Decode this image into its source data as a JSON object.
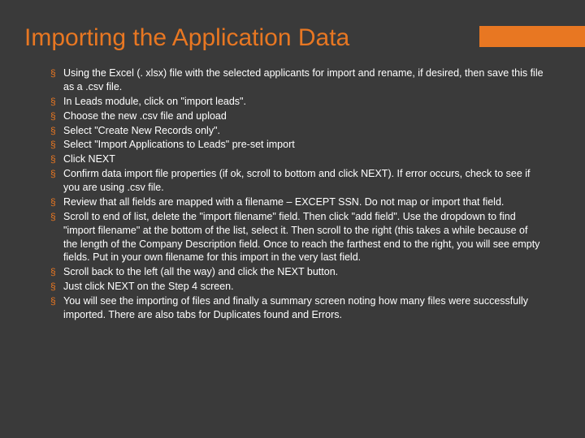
{
  "title": "Importing the Application Data",
  "bullets": [
    "Using the Excel (. xlsx) file with the selected applicants for import and rename, if desired, then save this file as a .csv file.",
    "In Leads module, click on \"import leads\".",
    "Choose the new .csv file and upload",
    "Select \"Create New Records only\".",
    "Select \"Import Applications to Leads\" pre-set import",
    "Click NEXT",
    "Confirm data import file properties (if ok, scroll to bottom and click NEXT).  If error occurs, check to see if you are using .csv file.",
    "Review that all fields are mapped with a filename – EXCEPT SSN.  Do not map or import that field.",
    "Scroll to end of list, delete the \"import filename\" field. Then click \"add field\". Use the dropdown to find \"import filename\" at the bottom of the list, select it.  Then scroll to the right (this takes a while because of the length of the Company Description field.  Once to reach the farthest end to the right, you will see empty fields.  Put in your own filename for this import in the very last field.",
    "Scroll back to the left (all the way) and click the NEXT button.",
    "Just click NEXT on the Step 4 screen.",
    "You will see the importing of files and finally a summary screen noting how many files were successfully imported.  There are also tabs for Duplicates found and Errors."
  ]
}
